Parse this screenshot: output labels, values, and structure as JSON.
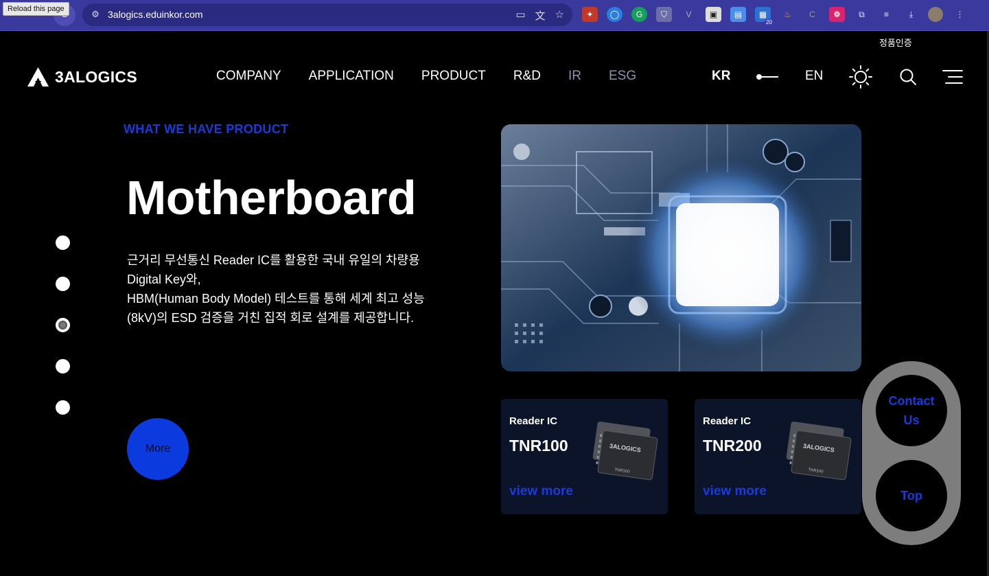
{
  "browser": {
    "tooltip": "Reload this page",
    "url": "3alogics.eduinkor.com",
    "extension_badge": "20",
    "extensions": [
      "puzzle-red-icon",
      "ring-icon",
      "grammarly-icon",
      "shield-icon",
      "v-icon",
      "screen-icon",
      "doc-icon",
      "calendar-icon",
      "fire-icon",
      "c-icon",
      "flower-icon",
      "extensions-icon"
    ]
  },
  "header": {
    "auth_label": "정품인증",
    "logo_text": "3ALOGICS",
    "nav": [
      {
        "label": "COMPANY"
      },
      {
        "label": "APPLICATION"
      },
      {
        "label": "PRODUCT"
      },
      {
        "label": "R&D"
      },
      {
        "label": "IR"
      },
      {
        "label": "ESG"
      }
    ],
    "lang_kr": "KR",
    "lang_en": "EN"
  },
  "hero": {
    "eyebrow": "WHAT WE HAVE PRODUCT",
    "title": "Motherboard",
    "description": "근거리 무선통신 Reader IC를 활용한 국내 유일의 차량용 Digital Key와,\nHBM(Human Body Model) 테스트를 통해 세계 최고 성능(8kV)의 ESD 검증을 거친 집적 회로 설계를 제공합니다.",
    "more_label": "More",
    "active_slide": 3,
    "slide_count": 5
  },
  "cards": [
    {
      "category": "Reader IC",
      "name": "TNR100",
      "link": "view more",
      "chip_brand": "3ALOGICS",
      "chip_model": "TNR100"
    },
    {
      "category": "Reader IC",
      "name": "TNR200",
      "link": "view more",
      "chip_brand": "3ALOGICS",
      "chip_model": "TNR100"
    }
  ],
  "floating": {
    "contact_label": "Contact\nUs",
    "top_label": "Top"
  },
  "colors": {
    "accent": "#1a3bd9",
    "button": "#0b3adf",
    "background": "#000000",
    "card": "#0c1429"
  }
}
